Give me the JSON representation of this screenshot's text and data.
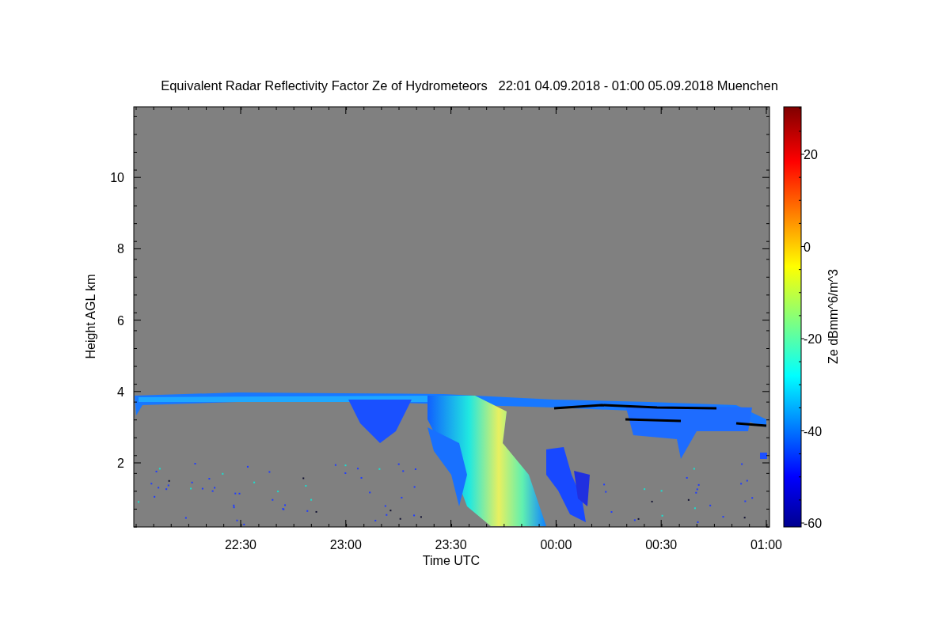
{
  "title": "Equivalent Radar Reflectivity Factor Ze of Hydrometeors   22:01 04.09.2018 - 01:00 05.09.2018 Muenchen",
  "x_axis": {
    "label": "Time UTC",
    "ticks": [
      "22:30",
      "23:00",
      "23:30",
      "00:00",
      "00:30",
      "01:00"
    ]
  },
  "y_axis": {
    "label": "Height AGL km",
    "ticks": [
      "10",
      "8",
      "6",
      "4",
      "2"
    ]
  },
  "colorbar": {
    "label": "Ze dBmm^6/m^3",
    "ticks": [
      "20",
      "0",
      "-20",
      "-40",
      "-60"
    ]
  }
}
